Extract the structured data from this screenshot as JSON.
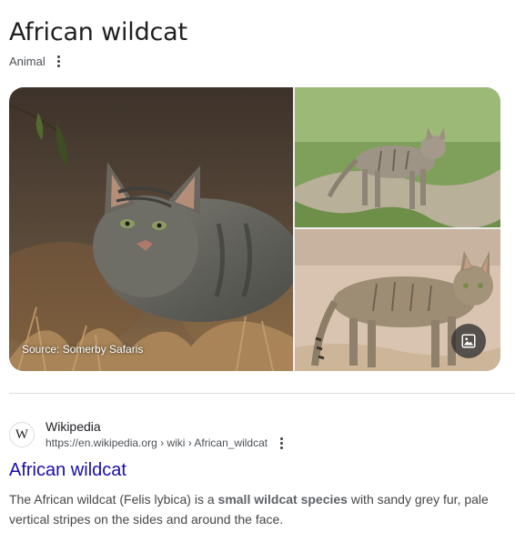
{
  "knowledge_panel": {
    "title": "African wildcat",
    "subtitle": "Animal",
    "more_icon": "three-dots-vertical-icon"
  },
  "gallery": {
    "source_label": "Source: Somerby Safaris",
    "images_button_icon": "image-icon",
    "images": [
      {
        "subject": "African wildcat lying in dry grass"
      },
      {
        "subject": "African wildcat walking on path"
      },
      {
        "subject": "African wildcat standing on sand"
      }
    ]
  },
  "result": {
    "favicon_letter": "W",
    "site_name": "Wikipedia",
    "url": "https://en.wikipedia.org › wiki › African_wildcat",
    "more_icon": "three-dots-vertical-icon",
    "title": "African wildcat",
    "snippet_before": "The African wildcat (Felis lybica) is a ",
    "snippet_bold": "small wildcat species",
    "snippet_after": " with sandy grey fur, pale vertical stripes on the sides and around the face."
  },
  "colors": {
    "link": "#1a0dab",
    "divider": "#dadce0",
    "text": "#202124",
    "muted": "#4d5156"
  }
}
